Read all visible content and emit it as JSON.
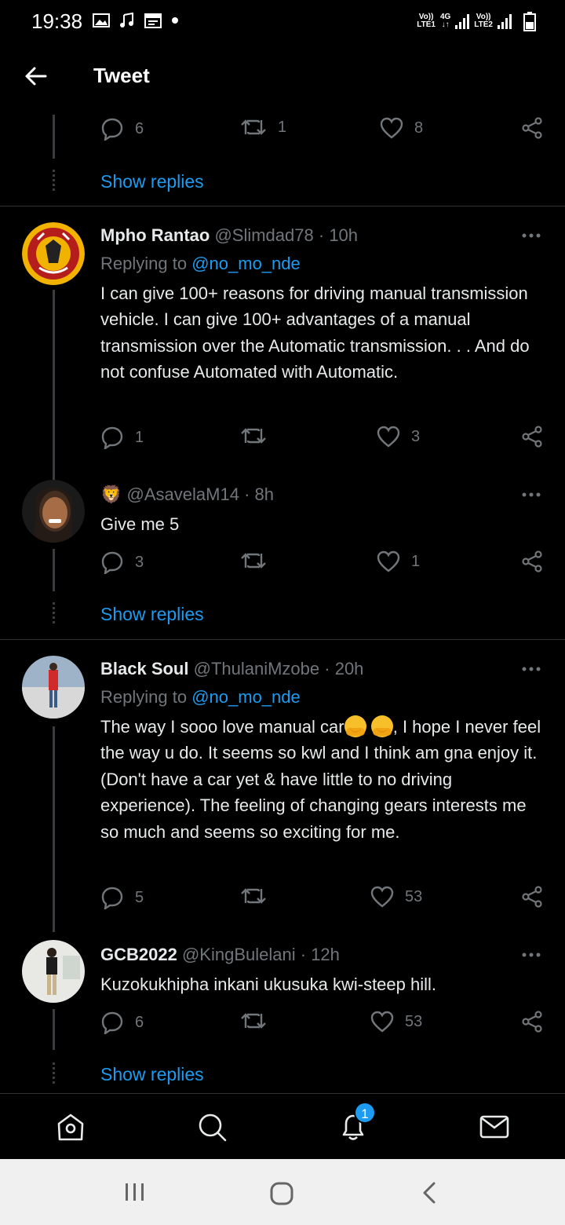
{
  "status_bar": {
    "time": "19:38",
    "sim1": "LTE1",
    "sim2": "LTE2",
    "volte": "Vo))",
    "network": "4G"
  },
  "header": {
    "title": "Tweet"
  },
  "top_partial": {
    "replies": "6",
    "retweets": "1",
    "likes": "8",
    "show_replies": "Show replies"
  },
  "tweets": [
    {
      "name": "Mpho Rantao",
      "handle": "@Slimdad78",
      "time": "· 10h",
      "replying_prefix": "Replying to",
      "replying_to": "@no_mo_nde",
      "text": "I can give 100+ reasons for driving manual transmission vehicle. I can give 100+ advantages of a manual transmission over the Automatic transmission.  . . And do not confuse Automated with Automatic.",
      "replies": "1",
      "retweets": "",
      "likes": "3"
    },
    {
      "name_emoji": "🦁",
      "handle": "@AsavelaM14",
      "time": "· 8h",
      "text": "Give me 5",
      "replies": "3",
      "retweets": "",
      "likes": "1",
      "show_replies": "Show replies"
    },
    {
      "name": "Black Soul",
      "handle": "@ThulaniMzobe",
      "time": "· 20h",
      "replying_prefix": "Replying to",
      "replying_to": "@no_mo_nde",
      "text_before": "The way I sooo love manual car",
      "text_after": ", I hope I never feel the way u do. It seems so kwl and I think am gna enjoy it. (Don't have a car yet & have little to no driving experience). The feeling of changing gears interests me so much and seems so exciting for me.",
      "replies": "5",
      "retweets": "",
      "likes": "53"
    },
    {
      "name": "GCB2022",
      "handle": "@KingBulelani",
      "time": "· 12h",
      "text": "Kuzokukhipha inkani ukusuka kwi-steep hill.",
      "replies": "6",
      "retweets": "",
      "likes": "53",
      "show_replies": "Show replies"
    }
  ],
  "bottom_nav": {
    "notifications_badge": "1"
  },
  "colors": {
    "accent": "#1d9bf0",
    "background": "#000000",
    "muted": "#71767b",
    "text": "#e7e9ea"
  }
}
